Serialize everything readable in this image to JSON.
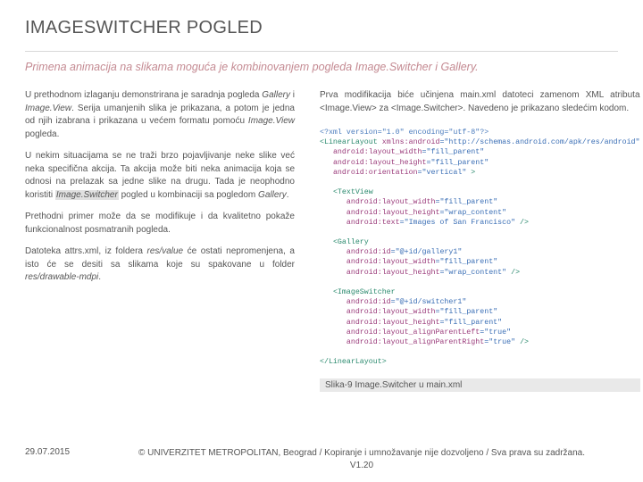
{
  "title": "IMAGESWITCHER POGLED",
  "subtitle": "Primena animacija na slikama moguća je kombinovanjem pogleda Image.Switcher i Gallery.",
  "left": {
    "p1_a": "U prethodnom izlaganju demonstrirana je saradnja pogleda ",
    "p1_g": "Gallery",
    "p1_b": " i ",
    "p1_iv": "Image.View",
    "p1_c": ". Serija umanjenih slika je prikazana, a potom je jedna od njih izabrana i prikazana u većem formatu pomoću ",
    "p1_iv2": "Image.View",
    "p1_d": " pogleda.",
    "p2_a": "U nekim situacijama se ne traži brzo pojavljivanje neke slike već neka specifična akcija. Ta akcija može biti neka animacija koja se odnosi na prelazak sa jedne slike na drugu. Tada je neophodno koristiti ",
    "p2_is": "Image.Switcher",
    "p2_b": " pogled u kombinaciji sa pogledom ",
    "p2_g": "Gallery",
    "p2_c": ".",
    "p3": "Prethodni primer može da se modifikuje i da kvalitetno pokaže funkcionalnost posmatranih pogleda.",
    "p4_a": "Datoteka attrs.xml, iz foldera ",
    "p4_i1": "res/value",
    "p4_b": " će ostati nepromenjena, a isto će se desiti sa slikama koje su spakovane u folder ",
    "p4_i2": "res/drawable-mdpi",
    "p4_c": "."
  },
  "right": {
    "p1": "Prva modifikacija biće učinjena main.xml datoteci zamenom XML atributa <Image.View> za <Image.Switcher>. Navedeno je prikazano sledećim kodom.",
    "caption": "Slika-9 Image.Switcher u main.xml"
  },
  "code": {
    "l1": "<?xml version=\"1.0\" encoding=\"utf-8\"?>",
    "l2a": "<LinearLayout",
    "l2b": "xmlns:android",
    "l2c": "=\"http://schemas.android.com/apk/res/android\"",
    "l3a": "android:layout_width",
    "l3b": "=\"fill_parent\"",
    "l4a": "android:layout_height",
    "l4b": "=\"fill_parent\"",
    "l5a": "android:orientation",
    "l5b": "=\"vertical\"",
    "l5c": " >",
    "l6a": "<TextView",
    "l7a": "android:layout_width",
    "l7b": "=\"fill_parent\"",
    "l8a": "android:layout_height",
    "l8b": "=\"wrap_content\"",
    "l9a": "android:text",
    "l9b": "=\"Images of San Francisco\"",
    "l9c": " />",
    "l10a": "<Gallery",
    "l11a": "android:id",
    "l11b": "=\"@+id/gallery1\"",
    "l12a": "android:layout_width",
    "l12b": "=\"fill_parent\"",
    "l13a": "android:layout_height",
    "l13b": "=\"wrap_content\"",
    "l13c": " />",
    "l14a": "<ImageSwitcher",
    "l15a": "android:id",
    "l15b": "=\"@+id/switcher1\"",
    "l16a": "android:layout_width",
    "l16b": "=\"fill_parent\"",
    "l17a": "android:layout_height",
    "l17b": "=\"fill_parent\"",
    "l18a": "android:layout_alignParentLeft",
    "l18b": "=\"true\"",
    "l19a": "android:layout_alignParentRight",
    "l19b": "=\"true\"",
    "l19c": " />",
    "l20": "</LinearLayout>"
  },
  "footer": {
    "date": "29.07.2015",
    "copy1": "© UNIVERZITET METROPOLITAN, Beograd / Kopiranje i umnožavanje nije dozvoljeno / Sva prava su zadržana.",
    "copy2": "V1.20"
  }
}
